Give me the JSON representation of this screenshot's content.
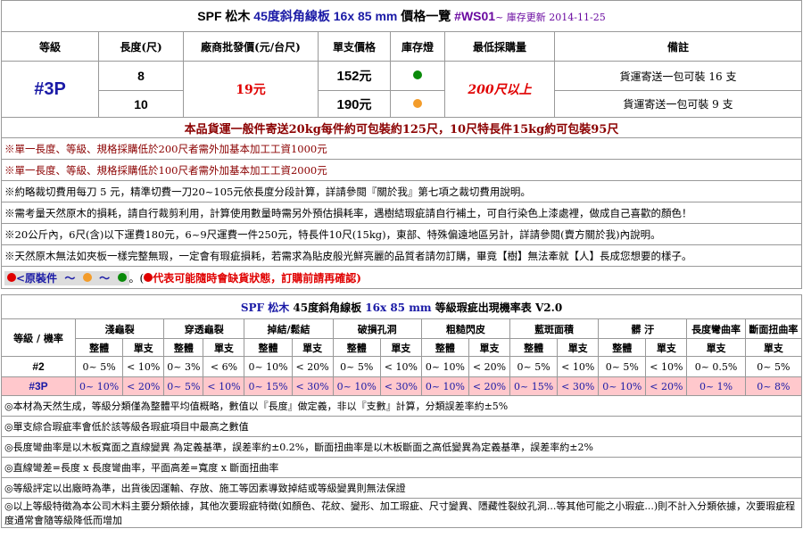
{
  "title": {
    "species": "SPF 松木",
    "product": "45度斜角線板",
    "size": "16x 85 mm",
    "price_list": "價格一覽",
    "code": "#WS01",
    "stock_update": "~ 庫存更新 2014-11-25"
  },
  "headers": [
    "等級",
    "長度(尺)",
    "廠商批發價(元/台尺)",
    "單支價格",
    "庫存燈",
    "最低採購量",
    "備註"
  ],
  "grade": "#3P",
  "wholesale": "19元",
  "min_qty": "200尺以上",
  "rows": [
    {
      "length": "8",
      "price_num": "152",
      "price_unit": "元",
      "stock_color": "#0a8a0a",
      "note": "貨運寄送一包可裝 16 支"
    },
    {
      "length": "10",
      "price_num": "190",
      "price_unit": "元",
      "stock_color": "#f39c2a",
      "note": "貨運寄送一包可裝 9 支"
    }
  ],
  "shipping": "本品貨運一般件寄送20kg每件約可包裝約125尺，10尺特長件15kg約可包裝95尺",
  "notes": [
    "※單一長度、等級、規格採購低於200尺者需外加基本加工工資1000元",
    "※單一長度、等級、規格採購低於100尺者需外加基本加工工資2000元",
    "※約略裁切費用每刀 5 元，精準切費一刀20~105元依長度分段計算，詳請參閱『關於我』第七項之裁切費用說明。",
    "※需考量天然原木的損耗，請自行裁剪利用，計算使用數量時需另外預估損耗率，遇樹結瑕疵請自行補土，可自行染色上漆處裡，做成自己喜歡的顏色！",
    "※20公斤內，6尺(含)以下運費180元，6~9尺運費一件250元，特長件10尺(15kg)，東部、特殊偏遠地區另計，詳請參閱(賣方關於我)內說明。",
    "※天然原木無法如夾板一樣完整無瑕，一定會有瑕疵損耗，若需求為貼皮般光鮮亮麗的品質者請勿訂購，畢竟【樹】無法牽就【人】長成您想要的樣子。"
  ],
  "legend": {
    "label": "<原裝件",
    "tilde": "～",
    "end": "。(",
    "warning": "代表可能隨時會缺貨狀態，訂購前請再確認",
    "close": ")",
    "colors": {
      "red": "#e00000",
      "orange": "#f39c2a",
      "green": "#0a8a0a"
    }
  },
  "defect_table": {
    "title_species": "SPF 松木",
    "title_product": "45度斜角線板",
    "title_size": "16x 85 mm",
    "title_rest": "等級瑕疵出現機率表 V2.0",
    "corner": "等級 / 機率",
    "categories": [
      "淺龜裂",
      "穿透龜裂",
      "掉結/鬆結",
      "破損孔洞",
      "粗糙閃皮",
      "藍斑面積",
      "髒 汙",
      "長度彎曲率",
      "斷面扭曲率"
    ],
    "sub_whole": "整體",
    "sub_single": "單支",
    "grades": [
      {
        "grade": "#2",
        "values": [
          "0~ 5%",
          "< 10%",
          "0~ 3%",
          "< 6%",
          "0~ 10%",
          "< 20%",
          "0~ 5%",
          "< 10%",
          "0~ 10%",
          "< 20%",
          "0~ 5%",
          "< 10%",
          "0~ 5%",
          "< 10%",
          "0~ 0.5%",
          "0~ 5%"
        ]
      },
      {
        "grade": "#3P",
        "values": [
          "0~ 10%",
          "< 20%",
          "0~ 5%",
          "< 10%",
          "0~ 15%",
          "< 30%",
          "0~ 10%",
          "< 30%",
          "0~ 10%",
          "< 20%",
          "0~ 15%",
          "< 30%",
          "0~ 10%",
          "< 20%",
          "0~ 1%",
          "0~ 8%"
        ]
      }
    ],
    "footnotes": [
      "◎本材為天然生成，等級分類僅為整體平均值概略，數值以『長度』做定義，非以『支數』計算，分類誤差率約±5%",
      "◎單支綜合瑕疵率會低於該等級各瑕疵項目中最高之數值",
      "◎長度彎曲率是以木板寬面之直線變異 為定義基準，誤差率約±0.2%，斷面扭曲率是以木板斷面之高低變異為定義基準，誤差率約±2%",
      "◎直線彎差=長度 x 長度彎曲率，平面高差=寬度 x 斷面扭曲率",
      "◎等級評定以出廠時為準，出貨後因運輸、存放、施工等因素導致掉結或等級變異則無法保證",
      "◎以上等級特徵為本公司木料主要分類依據，其他次要瑕疵特徵(如顏色、花紋、變形、加工瑕疵、尺寸變異、隱藏性裂紋孔洞...等其他可能之小瑕疵...)則不計入分類依據，次要瑕疵程度通常會隨等級降低而增加"
    ]
  }
}
